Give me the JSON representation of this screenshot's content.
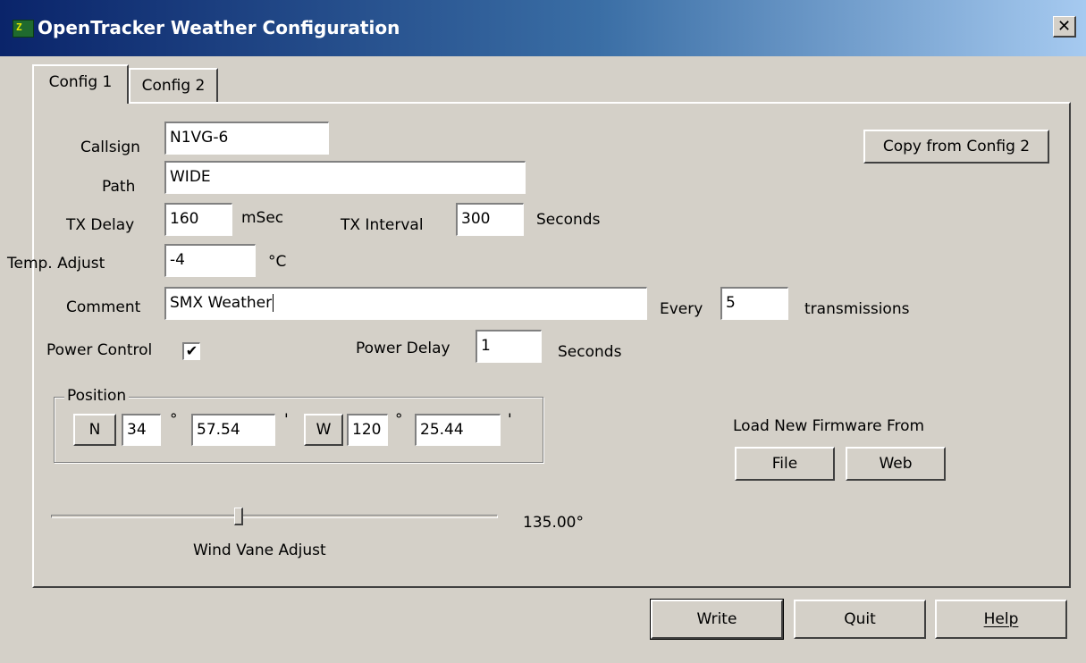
{
  "window": {
    "title": "OpenTracker Weather Configuration",
    "icon": "app-icon",
    "close_label": "✕"
  },
  "tabs": [
    {
      "label": "Config 1",
      "active": true
    },
    {
      "label": "Config 2",
      "active": false
    }
  ],
  "form": {
    "callsign": {
      "label": "Callsign",
      "value": "N1VG-6"
    },
    "path": {
      "label": "Path",
      "value": "WIDE"
    },
    "tx_delay": {
      "label": "TX Delay",
      "value": "160",
      "unit": "mSec"
    },
    "tx_interval": {
      "label": "TX Interval",
      "value": "300",
      "unit": "Seconds"
    },
    "temp_adjust": {
      "label": "Temp. Adjust",
      "value": "-4",
      "unit": "°C"
    },
    "comment": {
      "label": "Comment",
      "value": "SMX Weather"
    },
    "every": {
      "label": "Every",
      "value": "5",
      "unit": "transmissions"
    },
    "power_control": {
      "label": "Power Control",
      "checked": true,
      "mark": "✔"
    },
    "power_delay": {
      "label": "Power Delay",
      "value": "1",
      "unit": "Seconds"
    }
  },
  "copy_button": "Copy from Config 2",
  "position": {
    "label": "Position",
    "lat_hemisphere": "N",
    "lat_deg": "34",
    "lat_min": "57.54",
    "lon_hemisphere": "W",
    "lon_deg": "120",
    "lon_min": "25.44",
    "deg_symbol": "°",
    "min_symbol": "'"
  },
  "firmware": {
    "label": "Load New Firmware From",
    "file_button": "File",
    "web_button": "Web"
  },
  "wind_vane": {
    "label": "Wind Vane Adjust",
    "value_text": "135.00°",
    "value_fraction": 0.42
  },
  "footer": {
    "write_button": "Write",
    "quit_button": "Quit",
    "help_button": "Help"
  }
}
